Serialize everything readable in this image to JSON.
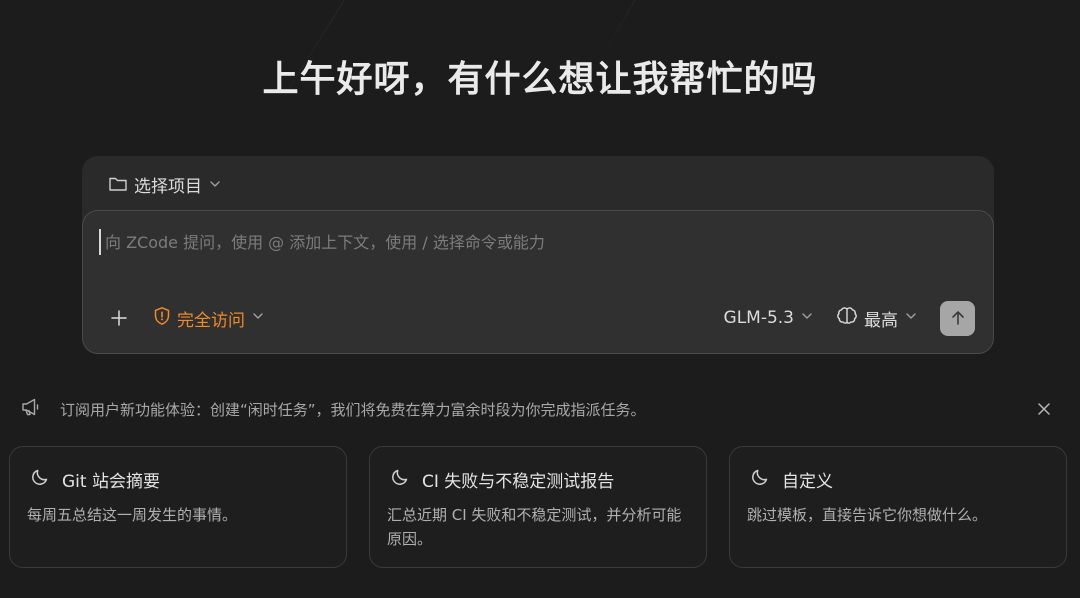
{
  "headline": "上午好呀，有什么想让我帮忙的吗",
  "composer": {
    "project_label": "选择项目",
    "prompt_placeholder": "向 ZCode 提问，使用 @ 添加上下文，使用 / 选择命令或能力",
    "prompt_value": "",
    "access_label": "完全访问",
    "model_label": "GLM-5.3",
    "effort_label": "最高",
    "access_color": "#f08a2a"
  },
  "notice": {
    "text": "订阅用户新功能体验：创建“闲时任务”，我们将免费在算力富余时段为你完成指派任务。"
  },
  "cards": [
    {
      "title": "Git 站会摘要",
      "desc": "每周五总结这一周发生的事情。",
      "icon": "moon-icon"
    },
    {
      "title": "CI 失败与不稳定测试报告",
      "desc": "汇总近期 CI 失败和不稳定测试，并分析可能原因。",
      "icon": "moon-icon"
    },
    {
      "title": "自定义",
      "desc": "跳过模板，直接告诉它你想做什么。",
      "icon": "moon-icon"
    }
  ]
}
